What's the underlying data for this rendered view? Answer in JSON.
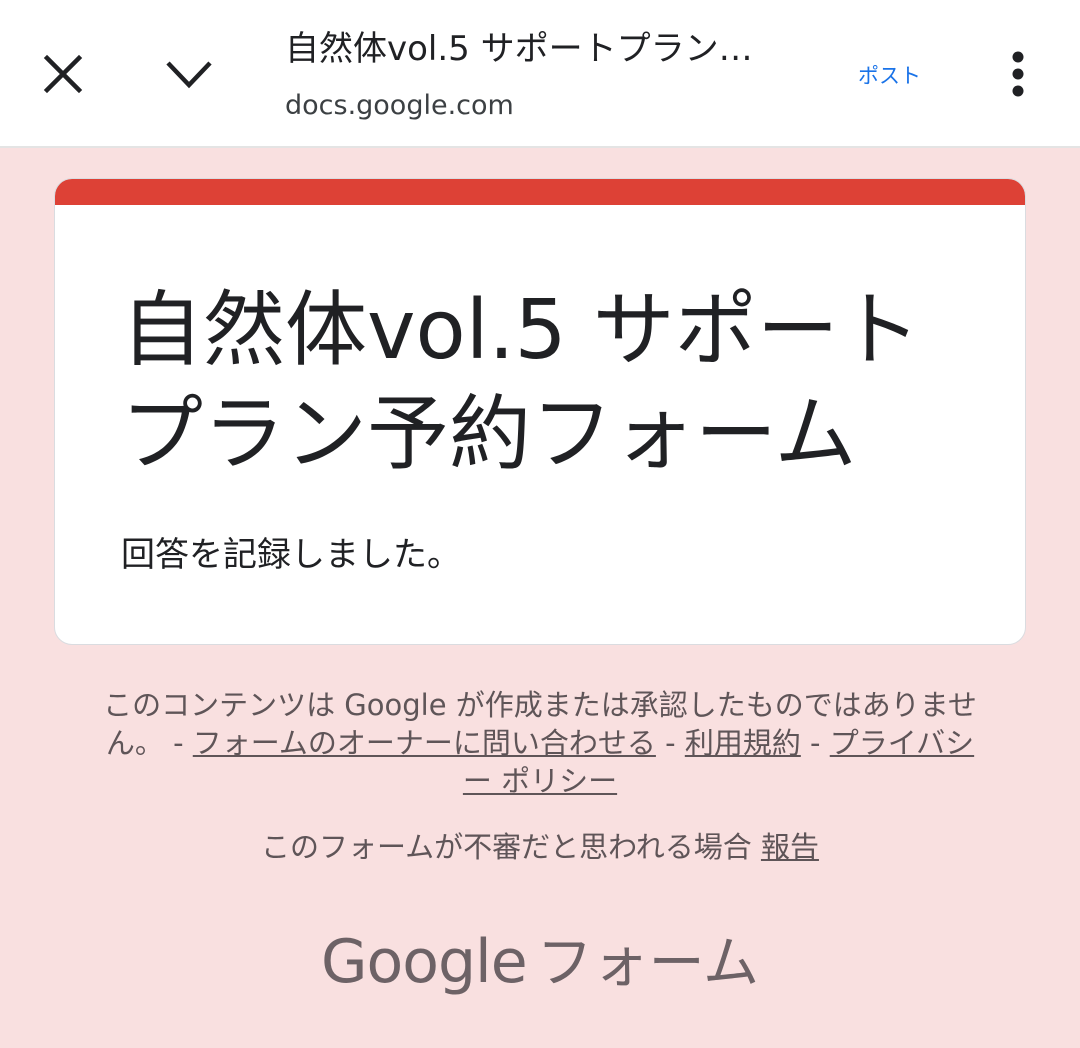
{
  "header": {
    "tab_title": "自然体vol.5 サポートプラン…",
    "url": "docs.google.com",
    "post_label": "ポスト",
    "close_icon": "close-icon",
    "collapse_icon": "chevron-down-icon",
    "menu_icon": "more-vert-icon"
  },
  "form": {
    "title": "自然体vol.5 サポートプラン予約フォーム",
    "confirmation": "回答を記録しました。",
    "accent_color": "#dd4136"
  },
  "footer": {
    "disclaimer_text": "このコンテンツは Google が作成または承認したものではありません。",
    "separator": " - ",
    "contact_owner_link": "フォームのオーナーに問い合わせる",
    "terms_link": "利用規約",
    "privacy_link": "プライバシー ポリシー",
    "report_text": "このフォームが不審だと思われる場合 ",
    "report_link": "報告",
    "brand_google": "Google",
    "brand_forms": "フォーム"
  },
  "colors": {
    "background": "#f9e0e0",
    "link": "#1a73e8"
  }
}
